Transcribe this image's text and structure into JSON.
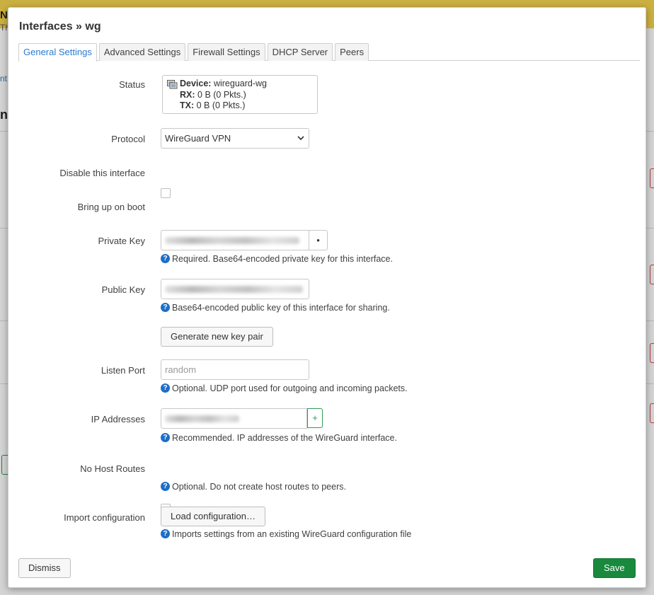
{
  "background": {
    "title_fragment": "N",
    "subtitle_fragment": "Th",
    "side_link_fragment": "nt",
    "side_heading_fragment": "nt"
  },
  "dialog": {
    "title": "Interfaces » wg",
    "tabs": [
      {
        "label": "General Settings",
        "active": true
      },
      {
        "label": "Advanced Settings",
        "active": false
      },
      {
        "label": "Firewall Settings",
        "active": false
      },
      {
        "label": "DHCP Server",
        "active": false
      },
      {
        "label": "Peers",
        "active": false
      }
    ],
    "status": {
      "label": "Status",
      "device_key": "Device:",
      "device_value": "wireguard-wg",
      "rx_key": "RX:",
      "rx_value": "0 B (0 Pkts.)",
      "tx_key": "TX:",
      "tx_value": "0 B (0 Pkts.)",
      "icon": "network-device-icon"
    },
    "protocol": {
      "label": "Protocol",
      "value": "WireGuard VPN"
    },
    "disable_interface": {
      "label": "Disable this interface",
      "checked": false
    },
    "bring_up_on_boot": {
      "label": "Bring up on boot",
      "checked": true
    },
    "private_key": {
      "label": "Private Key",
      "toggle_glyph": "•",
      "help": "Required. Base64-encoded private key for this interface."
    },
    "public_key": {
      "label": "Public Key",
      "help": "Base64-encoded public key of this interface for sharing."
    },
    "generate_button": "Generate new key pair",
    "listen_port": {
      "label": "Listen Port",
      "placeholder": "random",
      "help": "Optional. UDP port used for outgoing and incoming packets."
    },
    "ip_addresses": {
      "label": "IP Addresses",
      "add_glyph": "+",
      "help": "Recommended. IP addresses of the WireGuard interface."
    },
    "no_host_routes": {
      "label": "No Host Routes",
      "checked": false,
      "help": "Optional. Do not create host routes to peers."
    },
    "import_configuration": {
      "label": "Import configuration",
      "button": "Load configuration…",
      "help": "Imports settings from an existing WireGuard configuration file"
    },
    "help_glyph": "?",
    "dismiss_button": "Dismiss",
    "save_button": "Save"
  },
  "colors": {
    "accent": "#2a7ccd",
    "save": "#18893d",
    "add_button": "#2e9a57",
    "help_icon": "#1e6ec8"
  }
}
